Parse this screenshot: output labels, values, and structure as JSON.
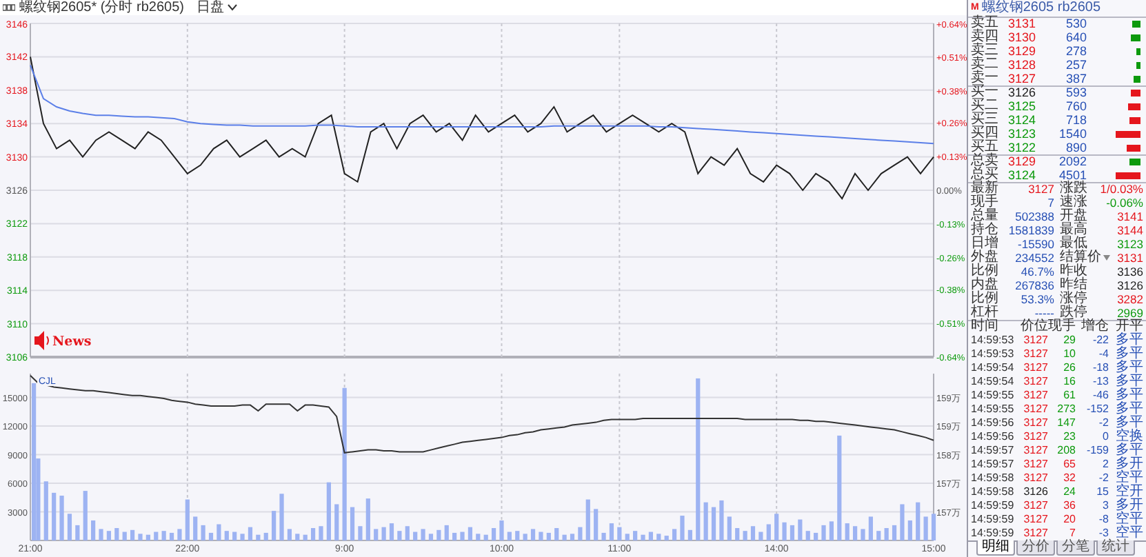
{
  "header": {
    "title": "螺纹钢2605* (分时 rb2605)",
    "session": "日盘"
  },
  "price_chart": {
    "news_label": "News",
    "chart_data": {
      "type": "line",
      "categories": [
        null,
        null,
        null,
        null,
        null,
        null,
        null,
        null,
        null,
        null,
        null,
        null,
        null,
        null,
        null,
        null,
        null,
        null,
        null,
        null,
        null,
        null,
        null,
        null,
        null,
        null,
        null,
        null,
        null,
        null,
        null,
        null,
        null,
        null,
        null,
        null,
        null,
        null,
        null,
        null,
        null,
        null,
        null,
        null,
        null,
        null,
        null,
        null,
        null,
        null,
        null,
        null,
        null,
        null,
        null,
        null,
        null,
        null,
        null,
        null,
        null,
        null,
        null,
        null,
        null,
        null,
        null,
        null,
        null,
        null
      ],
      "ylim": [
        3106,
        3146
      ],
      "grid": true,
      "yticks": [
        3146,
        3142,
        3138,
        3134,
        3130,
        3126,
        3122,
        3118,
        3114,
        3110,
        3106
      ],
      "y2lim": [
        -0.64,
        0.64
      ],
      "y2ticks": [
        {
          "value": 0.64,
          "label": "+0.64%"
        },
        {
          "value": 0.51,
          "label": "+0.51%"
        },
        {
          "value": 0.38,
          "label": "+0.38%"
        },
        {
          "value": 0.26,
          "label": "+0.26%"
        },
        {
          "value": 0.13,
          "label": "+0.13%"
        },
        {
          "value": 0,
          "label": "0.00%"
        },
        {
          "value": -0.13,
          "label": "-0.13%"
        },
        {
          "value": -0.26,
          "label": "-0.26%"
        },
        {
          "value": -0.38,
          "label": "-0.38%"
        },
        {
          "value": -0.51,
          "label": "-0.51%"
        },
        {
          "value": -0.64,
          "label": "-0.64%"
        }
      ],
      "series": [
        {
          "color": "#222222",
          "values": [
            3142,
            3134,
            3131,
            3132,
            3130,
            3132,
            3133,
            3132,
            3131,
            3133,
            3132,
            3130,
            3128,
            3129,
            3131,
            3132,
            3130,
            3131,
            3132,
            3130,
            3131,
            3130,
            3134,
            3135,
            3128,
            3127,
            3133,
            3134,
            3131,
            3134,
            3135,
            3133,
            3134,
            3132,
            3135,
            3133,
            3134,
            3135,
            3133,
            3134,
            3136,
            3133,
            3134,
            3135,
            3133,
            3134,
            3135,
            3134,
            3133,
            3134,
            3133,
            3128,
            3130,
            3129,
            3131,
            3128,
            3127,
            3129,
            3128,
            3126,
            3128,
            3127,
            3125,
            3128,
            3126,
            3128,
            3129,
            3130,
            3128,
            3130
          ]
        },
        {
          "color": "#5b7fe8",
          "values": [
            3141,
            3137,
            3136,
            3135.5,
            3135.2,
            3135,
            3135,
            3134.9,
            3134.8,
            3134.8,
            3134.7,
            3134.6,
            3134.2,
            3134,
            3133.9,
            3133.8,
            3133.8,
            3133.7,
            3133.7,
            3133.7,
            3133.7,
            3133.7,
            3133.8,
            3133.8,
            3133.7,
            3133.6,
            3133.6,
            3133.6,
            3133.6,
            3133.6,
            3133.6,
            3133.6,
            3133.6,
            3133.6,
            3133.6,
            3133.6,
            3133.6,
            3133.6,
            3133.6,
            3133.6,
            3133.7,
            3133.7,
            3133.7,
            3133.7,
            3133.7,
            3133.7,
            3133.7,
            3133.7,
            3133.6,
            3133.6,
            3133.5,
            3133.4,
            3133.3,
            3133.2,
            3133.1,
            3133,
            3132.9,
            3132.8,
            3132.7,
            3132.6,
            3132.5,
            3132.4,
            3132.3,
            3132.2,
            3132.1,
            3132,
            3131.9,
            3131.8,
            3131.7,
            3131.6
          ]
        }
      ]
    }
  },
  "volume_chart": {
    "chart_data": {
      "type": "bar",
      "categories": [
        "21:00",
        null,
        null,
        null,
        null,
        null,
        null,
        null,
        null,
        null,
        null,
        null,
        null,
        null,
        null,
        null,
        null,
        null,
        null,
        null,
        "22:00",
        null,
        null,
        null,
        null,
        null,
        null,
        null,
        null,
        null,
        null,
        null,
        null,
        null,
        null,
        null,
        null,
        null,
        null,
        null,
        "9:00",
        null,
        null,
        null,
        null,
        null,
        null,
        null,
        null,
        null,
        null,
        null,
        null,
        null,
        null,
        null,
        null,
        null,
        null,
        null,
        "10:00",
        null,
        null,
        null,
        null,
        null,
        null,
        null,
        null,
        null,
        null,
        null,
        null,
        null,
        null,
        "11:00",
        null,
        null,
        null,
        null,
        null,
        null,
        null,
        null,
        null,
        null,
        null,
        null,
        null,
        null,
        null,
        null,
        null,
        null,
        null,
        "14:00",
        null,
        null,
        null,
        null,
        null,
        null,
        null,
        null,
        null,
        null,
        null,
        null,
        null,
        null,
        null,
        null,
        null,
        null,
        null,
        "15:00"
      ],
      "ylim": [
        0,
        17500
      ],
      "grid": true,
      "yticks": [
        15000,
        12000,
        9000,
        6000,
        3000
      ],
      "y2lim": [
        156.2,
        159.7
      ],
      "y2ticks": [
        {
          "value": 159.2,
          "label": "159万"
        },
        {
          "value": 158.6,
          "label": "159万"
        },
        {
          "value": 158.0,
          "label": "158万"
        },
        {
          "value": 157.4,
          "label": "157万"
        },
        {
          "value": 156.8,
          "label": "157万"
        }
      ],
      "series": [
        {
          "name": "CJL",
          "color": "#9db3f2",
          "values": [
            16500,
            8600,
            6200,
            5000,
            4700,
            2800,
            1600,
            5200,
            2100,
            1200,
            1000,
            1300,
            900,
            1100,
            700,
            600,
            900,
            1000,
            800,
            1200,
            4300,
            2500,
            1600,
            800,
            1700,
            1000,
            900,
            700,
            1400,
            600,
            800,
            3100,
            4900,
            1200,
            700,
            600,
            1300,
            1500,
            6100,
            3800,
            16000,
            3500,
            1500,
            4400,
            1200,
            1400,
            1800,
            1000,
            1500,
            900,
            1200,
            700,
            1100,
            1600,
            800,
            900,
            1400,
            700,
            600,
            1300,
            2100,
            900,
            1000,
            700,
            1200,
            900,
            800,
            1300,
            600,
            700,
            1400,
            4300,
            3300,
            800,
            1800,
            1400,
            700,
            1000,
            600,
            900,
            700,
            500,
            1200,
            2600,
            1100,
            17000,
            4000,
            3500,
            4200,
            2500,
            1300,
            1000,
            1500,
            900,
            1700,
            2800,
            1900,
            1600,
            2200,
            1000,
            800,
            1600,
            2000,
            11000,
            1800,
            1500,
            1200,
            2500,
            1000,
            1300,
            1600,
            3800,
            2100,
            4000,
            2500,
            2800
          ]
        },
        {
          "type": "line",
          "color": "#333333",
          "values": [
            17300,
            16500,
            16300,
            16100,
            16000,
            15900,
            15800,
            15700,
            15700,
            15600,
            15500,
            15400,
            15300,
            15200,
            15200,
            15100,
            15000,
            14900,
            14700,
            14600,
            14500,
            14300,
            14200,
            14100,
            14100,
            14100,
            14100,
            14200,
            14200,
            13600,
            14300,
            14300,
            14300,
            14300,
            13600,
            14200,
            14200,
            14100,
            14000,
            13000,
            9200,
            9300,
            9400,
            9500,
            9500,
            9400,
            9400,
            9300,
            9300,
            9300,
            9300,
            9500,
            9700,
            9900,
            10100,
            10300,
            10400,
            10500,
            10600,
            10700,
            10800,
            11000,
            11100,
            11300,
            11400,
            11600,
            11700,
            11800,
            11900,
            12100,
            12200,
            12300,
            12400,
            12600,
            12700,
            12700,
            12700,
            12700,
            12800,
            12800,
            12800,
            12800,
            12800,
            12800,
            12800,
            12800,
            12800,
            12800,
            12800,
            12800,
            12800,
            12700,
            12700,
            12700,
            12700,
            12700,
            12700,
            12700,
            12600,
            12600,
            12500,
            12500,
            12400,
            12300,
            12200,
            12100,
            12000,
            11900,
            11800,
            11700,
            11600,
            11400,
            11200,
            11000,
            10800,
            10500
          ]
        }
      ]
    }
  },
  "quote": {
    "badge": "M",
    "title": "螺纹钢2605 rb2605"
  },
  "asks": [
    {
      "label": "卖五",
      "price": {
        "text": "3131",
        "color": "#e5161d"
      },
      "volume": "530"
    },
    {
      "label": "卖四",
      "price": {
        "text": "3130",
        "color": "#e5161d"
      },
      "volume": "640"
    },
    {
      "label": "卖三",
      "price": {
        "text": "3129",
        "color": "#e5161d"
      },
      "volume": "278"
    },
    {
      "label": "卖二",
      "price": {
        "text": "3128",
        "color": "#e5161d"
      },
      "volume": "257"
    },
    {
      "label": "卖一",
      "price": {
        "text": "3127",
        "color": "#e5161d"
      },
      "volume": "387"
    }
  ],
  "bids": [
    {
      "label": "买一",
      "price": {
        "text": "3126",
        "color": "#222222"
      },
      "volume": "593"
    },
    {
      "label": "买二",
      "price": {
        "text": "3125",
        "color": "#0d9a0d"
      },
      "volume": "760"
    },
    {
      "label": "买三",
      "price": {
        "text": "3124",
        "color": "#0d9a0d"
      },
      "volume": "718"
    },
    {
      "label": "买四",
      "price": {
        "text": "3123",
        "color": "#0d9a0d"
      },
      "volume": "1540"
    },
    {
      "label": "买五",
      "price": {
        "text": "3122",
        "color": "#0d9a0d"
      },
      "volume": "890"
    }
  ],
  "totals": [
    {
      "label": "总卖",
      "price": {
        "text": "3129",
        "color": "#e5161d"
      },
      "volume": "2092",
      "color": "#0d9a0d"
    },
    {
      "label": "总买",
      "price": {
        "text": "3124",
        "color": "#0d9a0d"
      },
      "volume": "4501",
      "color": "#e5161d"
    }
  ],
  "stats": [
    {
      "left": {
        "label": "最新",
        "value": {
          "text": "3127",
          "color": "#e5161d"
        }
      },
      "right": {
        "label": "涨跌",
        "value": {
          "text": "1/0.03%",
          "color": "#e5161d"
        }
      }
    },
    {
      "left": {
        "label": "现手",
        "value": {
          "text": "7",
          "color": "#2750b5"
        }
      },
      "right": {
        "label": "速涨",
        "value": {
          "text": "-0.06%",
          "color": "#0d9a0d"
        }
      }
    },
    {
      "left": {
        "label": "总量",
        "value": {
          "text": "502388",
          "color": "#2750b5"
        }
      },
      "right": {
        "label": "开盘",
        "value": {
          "text": "3141",
          "color": "#e5161d"
        }
      }
    },
    {
      "left": {
        "label": "持仓",
        "value": {
          "text": "1581839",
          "color": "#2750b5"
        }
      },
      "right": {
        "label": "最高",
        "value": {
          "text": "3144",
          "color": "#e5161d"
        }
      }
    },
    {
      "left": {
        "label": "日增",
        "value": {
          "text": "-15590",
          "color": "#2750b5"
        }
      },
      "right": {
        "label": "最低",
        "value": {
          "text": "3123",
          "color": "#0d9a0d"
        }
      }
    },
    {
      "left": {
        "label": "外盘",
        "value": {
          "text": "234552",
          "color": "#2750b5"
        }
      },
      "right": {
        "label": "结算价",
        "dropdown": true,
        "value": {
          "text": "3131",
          "color": "#e5161d"
        }
      }
    },
    {
      "left": {
        "label": "比例",
        "value": {
          "text": "46.7%",
          "color": "#2750b5"
        }
      },
      "right": {
        "label": "昨收",
        "value": {
          "text": "3136",
          "color": "#222222"
        }
      }
    },
    {
      "left": {
        "label": "内盘",
        "value": {
          "text": "267836",
          "color": "#2750b5"
        }
      },
      "right": {
        "label": "昨结",
        "value": {
          "text": "3126",
          "color": "#222222"
        }
      }
    },
    {
      "left": {
        "label": "比例",
        "value": {
          "text": "53.3%",
          "color": "#2750b5"
        }
      },
      "right": {
        "label": "涨停",
        "value": {
          "text": "3282",
          "color": "#e5161d"
        }
      }
    },
    {
      "left": {
        "label": "杠杆",
        "value": {
          "text": "-----",
          "color": "#2750b5"
        }
      },
      "right": {
        "label": "跌停",
        "value": {
          "text": "2969",
          "color": "#0d9a0d"
        }
      }
    }
  ],
  "ticks": {
    "columns": [
      "时间",
      "价位",
      "现手",
      "增仓",
      "开平"
    ],
    "rows": [
      {
        "time": "14:59:53",
        "price": {
          "text": "3127",
          "color": "#e5161d"
        },
        "volume": {
          "text": "29",
          "color": "#0d9a0d"
        },
        "oi_change": "-22",
        "type": "多平"
      },
      {
        "time": "14:59:53",
        "price": {
          "text": "3127",
          "color": "#e5161d"
        },
        "volume": {
          "text": "10",
          "color": "#0d9a0d"
        },
        "oi_change": "-4",
        "type": "多平"
      },
      {
        "time": "14:59:54",
        "price": {
          "text": "3127",
          "color": "#e5161d"
        },
        "volume": {
          "text": "26",
          "color": "#0d9a0d"
        },
        "oi_change": "-18",
        "type": "多平"
      },
      {
        "time": "14:59:54",
        "price": {
          "text": "3127",
          "color": "#e5161d"
        },
        "volume": {
          "text": "16",
          "color": "#0d9a0d"
        },
        "oi_change": "-13",
        "type": "多平"
      },
      {
        "time": "14:59:55",
        "price": {
          "text": "3127",
          "color": "#e5161d"
        },
        "volume": {
          "text": "61",
          "color": "#0d9a0d"
        },
        "oi_change": "-46",
        "type": "多平"
      },
      {
        "time": "14:59:55",
        "price": {
          "text": "3127",
          "color": "#e5161d"
        },
        "volume": {
          "text": "273",
          "color": "#0d9a0d"
        },
        "oi_change": "-152",
        "type": "多平"
      },
      {
        "time": "14:59:56",
        "price": {
          "text": "3127",
          "color": "#e5161d"
        },
        "volume": {
          "text": "147",
          "color": "#0d9a0d"
        },
        "oi_change": "-2",
        "type": "多平"
      },
      {
        "time": "14:59:56",
        "price": {
          "text": "3127",
          "color": "#e5161d"
        },
        "volume": {
          "text": "23",
          "color": "#0d9a0d"
        },
        "oi_change": "0",
        "type": "空换"
      },
      {
        "time": "14:59:57",
        "price": {
          "text": "3127",
          "color": "#e5161d"
        },
        "volume": {
          "text": "208",
          "color": "#0d9a0d"
        },
        "oi_change": "-159",
        "type": "多平"
      },
      {
        "time": "14:59:57",
        "price": {
          "text": "3127",
          "color": "#e5161d"
        },
        "volume": {
          "text": "65",
          "color": "#e5161d"
        },
        "oi_change": "2",
        "type": "多开"
      },
      {
        "time": "14:59:58",
        "price": {
          "text": "3127",
          "color": "#e5161d"
        },
        "volume": {
          "text": "32",
          "color": "#e5161d"
        },
        "oi_change": "-2",
        "type": "空平"
      },
      {
        "time": "14:59:58",
        "price": {
          "text": "3126",
          "color": "#222222"
        },
        "volume": {
          "text": "24",
          "color": "#0d9a0d"
        },
        "oi_change": "15",
        "type": "空开"
      },
      {
        "time": "14:59:59",
        "price": {
          "text": "3127",
          "color": "#e5161d"
        },
        "volume": {
          "text": "36",
          "color": "#e5161d"
        },
        "oi_change": "3",
        "type": "多开"
      },
      {
        "time": "14:59:59",
        "price": {
          "text": "3127",
          "color": "#e5161d"
        },
        "volume": {
          "text": "20",
          "color": "#e5161d"
        },
        "oi_change": "-8",
        "type": "空平"
      },
      {
        "time": "14:59:59",
        "price": {
          "text": "3127",
          "color": "#e5161d"
        },
        "volume": {
          "text": "7",
          "color": "#e5161d"
        },
        "oi_change": "-3",
        "type": "空平"
      }
    ]
  },
  "bottom_tabs": [
    {
      "label": "明细",
      "selected": true
    },
    {
      "label": "分价",
      "selected": false
    },
    {
      "label": "分笔",
      "selected": false
    },
    {
      "label": "统计",
      "selected": false
    }
  ]
}
